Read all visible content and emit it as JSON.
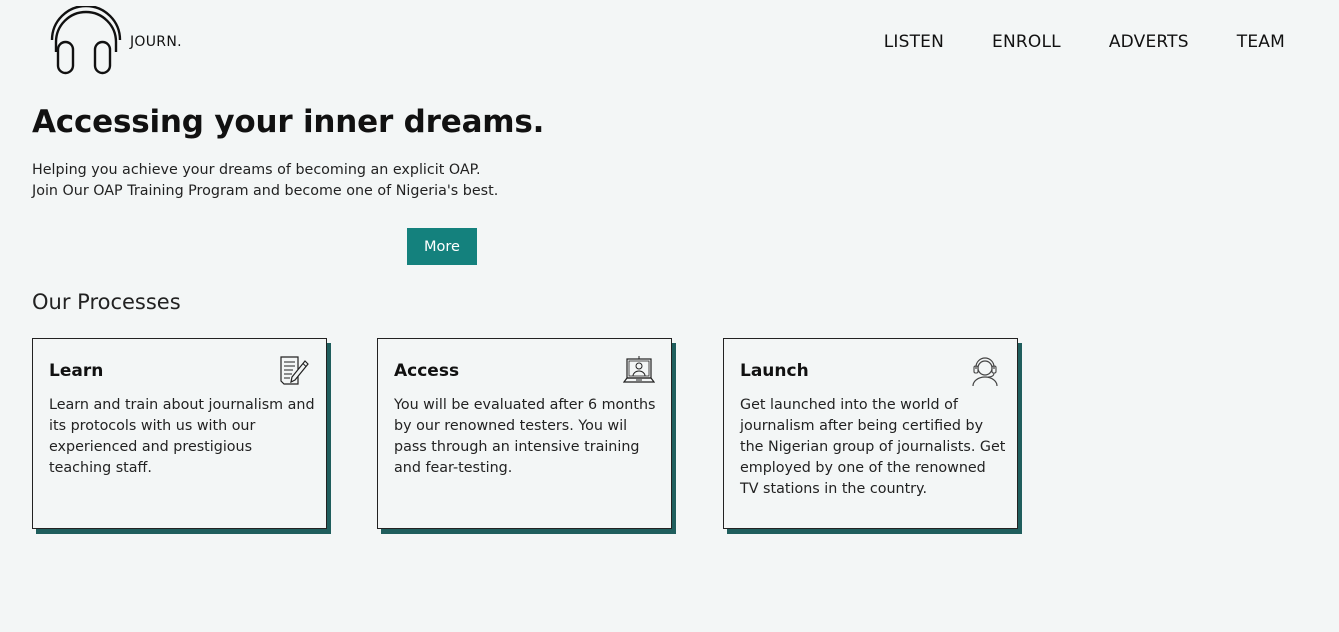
{
  "header": {
    "brand": "JOURN.",
    "logo_icon": "headphones-icon",
    "nav": [
      {
        "label": "LISTEN"
      },
      {
        "label": "ENROLL"
      },
      {
        "label": "ADVERTS"
      },
      {
        "label": "TEAM"
      }
    ]
  },
  "hero": {
    "title": "Accessing your inner dreams.",
    "text": "Helping you achieve your dreams of becoming an explicit OAP. Join Our OAP Training Program and become one of Nigeria's best.",
    "button_label": "More"
  },
  "processes": {
    "title": "Our Processes",
    "cards": [
      {
        "title": "Learn",
        "icon": "document-pencil-icon",
        "text": "Learn and train about journalism and its protocols with us with our experienced and prestigious teaching staff."
      },
      {
        "title": "Access",
        "icon": "laptop-user-icon",
        "text": "You will be evaluated after 6 months by our renowned testers. You wil pass through an intensive training and fear-testing."
      },
      {
        "title": "Launch",
        "icon": "headset-user-icon",
        "text": "Get launched into the world of journalism after being certified by the Nigerian group of journalists. Get employed by one of the renowned TV stations in the country."
      }
    ]
  },
  "colors": {
    "background": "#f3f6f6",
    "accent": "#14817d",
    "card_shadow": "#1f5e5d"
  }
}
